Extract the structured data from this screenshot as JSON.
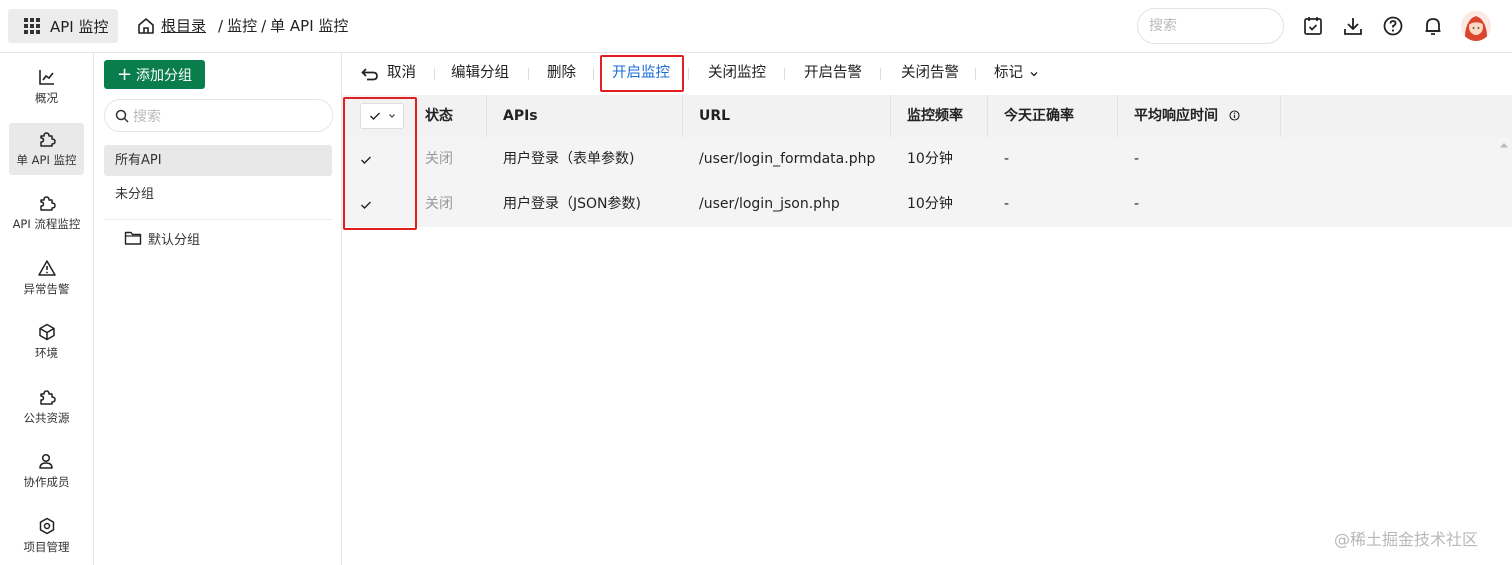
{
  "app": {
    "button_label": "API 监控"
  },
  "breadcrumb": {
    "root": "根目录",
    "sep1": "/",
    "item1": "监控",
    "sep2": "/",
    "item2": "单 API 监控"
  },
  "topbar": {
    "search_placeholder": "搜索",
    "icons": [
      "calendar-check-icon",
      "download-icon",
      "help-icon",
      "bell-icon",
      "avatar"
    ]
  },
  "nav": {
    "items": [
      {
        "label": "概况",
        "icon": "chart-line-icon"
      },
      {
        "label": "单 API 监控",
        "icon": "puzzle-icon",
        "active": true
      },
      {
        "label": "API 流程监控",
        "icon": "puzzle-icon"
      },
      {
        "label": "异常告警",
        "icon": "warning-icon"
      },
      {
        "label": "环境",
        "icon": "cube-icon"
      },
      {
        "label": "公共资源",
        "icon": "puzzle-icon"
      },
      {
        "label": "协作成员",
        "icon": "users-icon"
      },
      {
        "label": "项目管理",
        "icon": "gear-icon"
      }
    ]
  },
  "groups": {
    "add_button": "添加分组",
    "search_placeholder": "搜索",
    "items": [
      {
        "label": "所有API",
        "active": true
      },
      {
        "label": "未分组"
      }
    ],
    "folder": "默认分组"
  },
  "toolbar": {
    "cancel": "取消",
    "edit_group": "编辑分组",
    "delete": "删除",
    "start_monitor": "开启监控",
    "stop_monitor": "关闭监控",
    "start_alert": "开启告警",
    "stop_alert": "关闭告警",
    "mark": "标记"
  },
  "table": {
    "headers": {
      "status": "状态",
      "apis": "APIs",
      "url": "URL",
      "frequency": "监控频率",
      "accuracy": "今天正确率",
      "avg_response": "平均响应时间"
    },
    "rows": [
      {
        "status": "关闭",
        "api": "用户登录（表单参数)",
        "url": "/user/login_formdata.php",
        "frequency": "10分钟",
        "accuracy": "-",
        "avg_response": "-",
        "checked": true
      },
      {
        "status": "关闭",
        "api": "用户登录（JSON参数)",
        "url": "/user/login_json.php",
        "frequency": "10分钟",
        "accuracy": "-",
        "avg_response": "-",
        "checked": true
      }
    ]
  },
  "watermark": "@稀土掘金技术社区",
  "colors": {
    "primary_green": "#0a7d4c",
    "highlight_red": "#e02020",
    "link_blue": "#1a6dd9"
  }
}
